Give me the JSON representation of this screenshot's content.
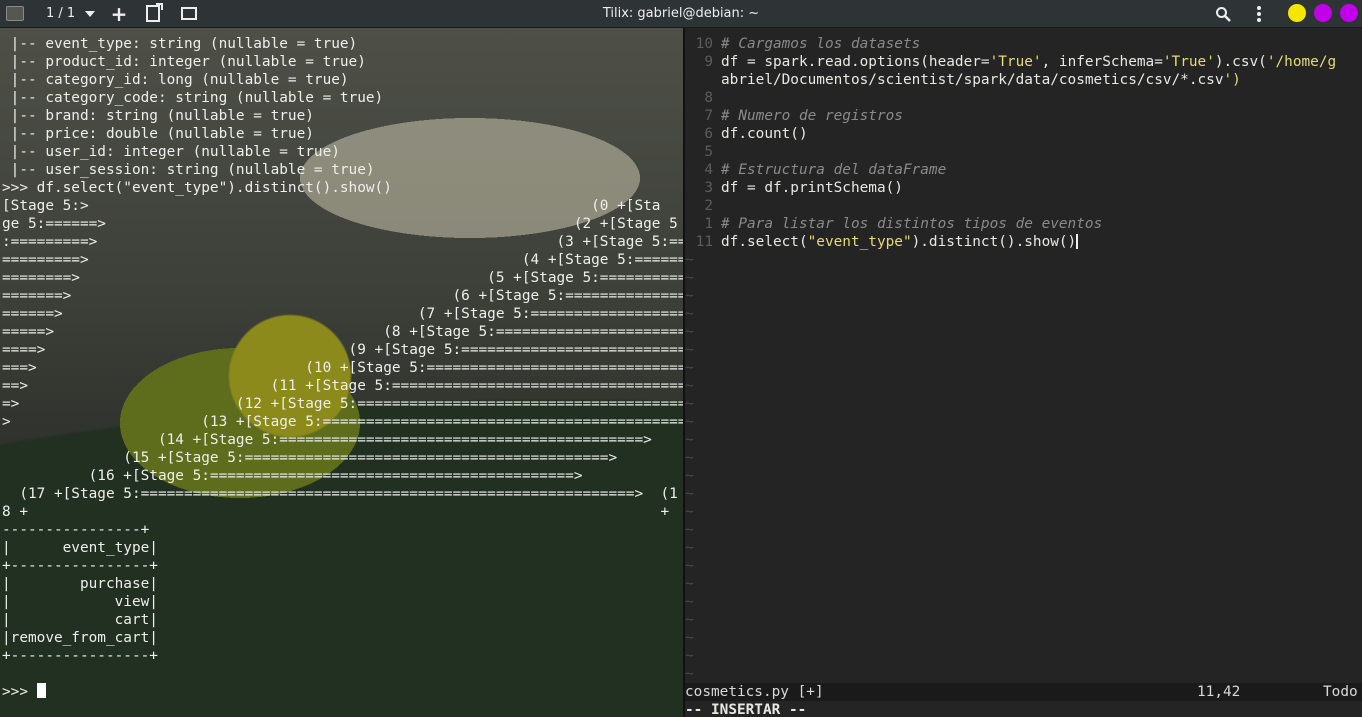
{
  "titlebar": {
    "title": "Tilix: gabriel@debian: ~",
    "session_count": "1 / 1",
    "add_label": "+",
    "colors": {
      "min": "#f5e600",
      "max": "#c000e6",
      "close": "#c000e6"
    }
  },
  "terminal": {
    "schema_lines": [
      " |-- event_type: string (nullable = true)",
      " |-- product_id: integer (nullable = true)",
      " |-- category_id: long (nullable = true)",
      " |-- category_code: string (nullable = true)",
      " |-- brand: string (nullable = true)",
      " |-- price: double (nullable = true)",
      " |-- user_id: integer (nullable = true)",
      " |-- user_session: string (nullable = true)"
    ],
    "command": ">>> df.select(\"event_type\").distinct().show()",
    "progress_lines": [
      "[Stage 5:>                                                          (0 +[Sta",
      "ge 5:======>                                                      (2 +[Stage 5",
      ":=========>                                                     (3 +[Stage 5:===",
      "=========>                                                  (4 +[Stage 5:=======",
      "========>                                               (5 +[Stage 5:===========",
      "=======>                                            (6 +[Stage 5:===============",
      "======>                                         (7 +[Stage 5:===================",
      "=====>                                      (8 +[Stage 5:=======================",
      "====>                                   (9 +[Stage 5:===========================",
      "===>                               (10 +[Stage 5:===============================",
      "==>                            (11 +[Stage 5:===================================",
      "=>                         (12 +[Stage 5:=======================================",
      ">                      (13 +[Stage 5:==========================================>",
      "                  (14 +[Stage 5:==========================================>",
      "              (15 +[Stage 5:==========================================>",
      "          (16 +[Stage 5:==========================================>",
      "  (17 +[Stage 5:=========================================================>  (1",
      "8 +                                                                         +"
    ],
    "table_lines": [
      "----------------+",
      "|      event_type|",
      "+----------------+",
      "|        purchase|",
      "|            view|",
      "|            cart|",
      "|remove_from_cart|",
      "+----------------+"
    ],
    "prompt": ">>> "
  },
  "editor": {
    "lines": [
      {
        "num": "10",
        "code": "# Cargamos los datasets"
      },
      {
        "num": "9",
        "code": "df = spark.read.options(header='True', inferSchema='True').csv('/home/g"
      },
      {
        "num": "",
        "code": "abriel/Documentos/scientist/spark/data/cosmetics/csv/*.csv')"
      },
      {
        "num": "8",
        "code": ""
      },
      {
        "num": "7",
        "code": "# Numero de registros"
      },
      {
        "num": "6",
        "code": "df.count()"
      },
      {
        "num": "5",
        "code": ""
      },
      {
        "num": "4",
        "code": "# Estructura del dataFrame"
      },
      {
        "num": "3",
        "code": "df = df.printSchema()"
      },
      {
        "num": "2",
        "code": ""
      },
      {
        "num": "1",
        "code": "# Para listar los distintos tipos de eventos"
      },
      {
        "num": "11",
        "code": "df.select(\"event_type\").distinct().show()"
      }
    ],
    "tilde": "~",
    "status": {
      "filename": "cosmetics.py [+]",
      "position": "11,42",
      "extent": "Todo"
    },
    "mode": "-- INSERTAR --"
  }
}
